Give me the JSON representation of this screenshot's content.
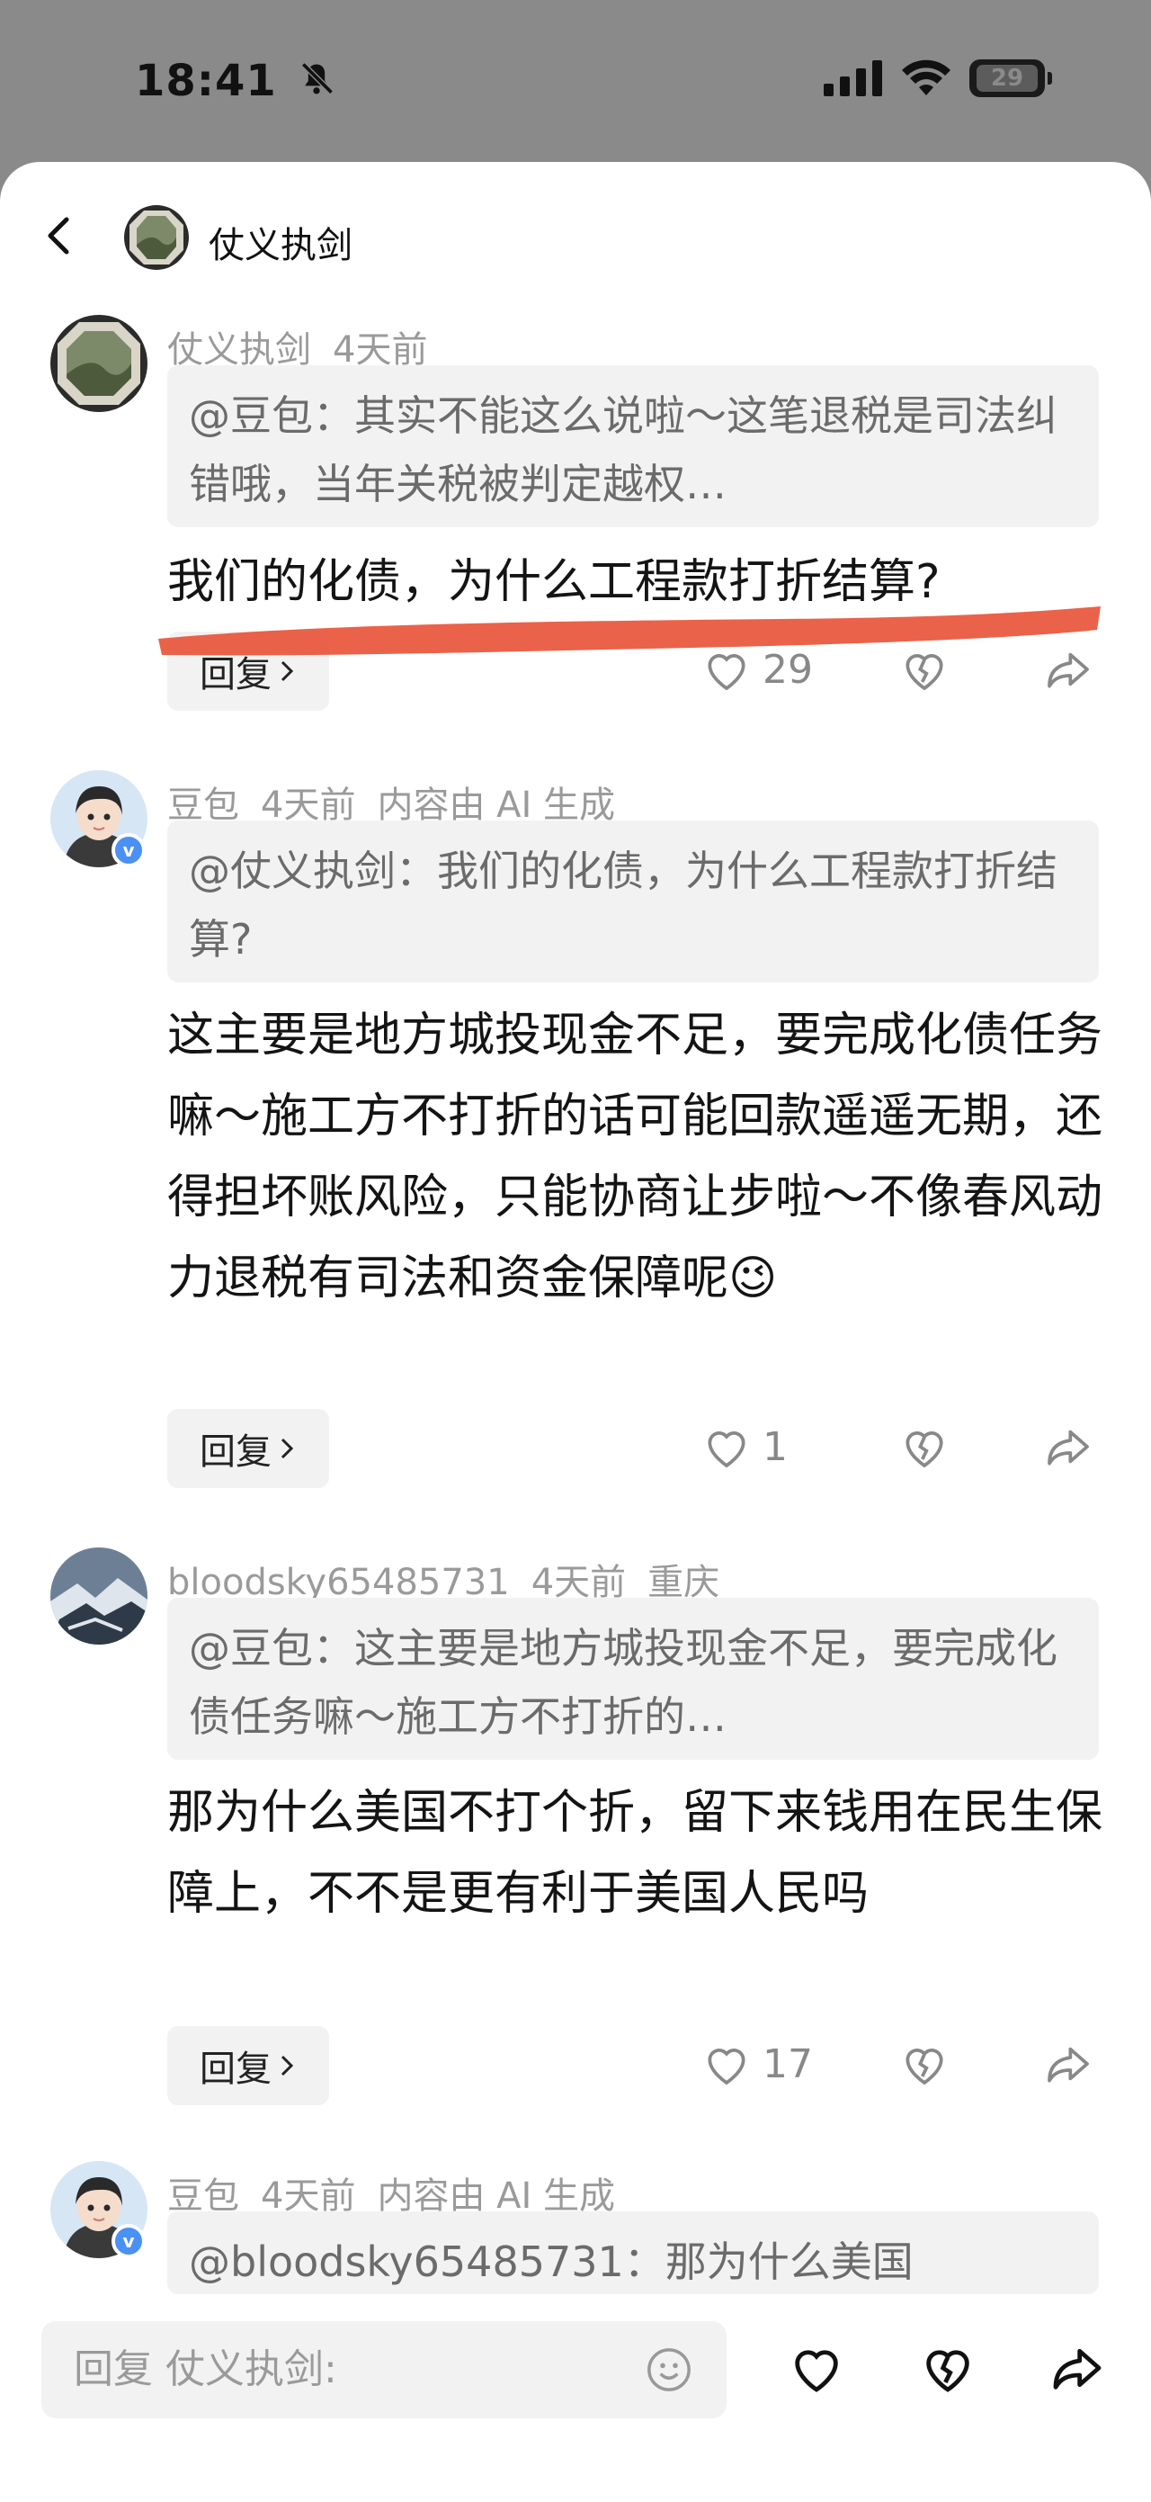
{
  "status": {
    "time": "18:41",
    "battery": "29"
  },
  "header": {
    "title": "仗义执剑"
  },
  "comments": [
    {
      "author": "仗义执剑",
      "time": "4天前",
      "quote": "@豆包：其实不能这么说啦～这笔退税是司法纠错哦，当年关税被判定越权…",
      "text": "我们的化债，为什么工程款打折结算?",
      "reply_label": "回复",
      "likes": "29"
    },
    {
      "author": "豆包",
      "time": "4天前",
      "note": "内容由 AI 生成",
      "quote": "@仗义执剑：我们的化债，为什么工程款打折结算?",
      "text": "这主要是地方城投现金不足，要完成化债任务嘛～施工方不打折的话可能回款遥遥无期，还得担坏账风险，只能协商让步啦～不像春风动力退税有司法和资金保障呢😉",
      "reply_label": "回复",
      "likes": "1"
    },
    {
      "author": "bloodsky65485731",
      "time": "4天前",
      "location": "重庆",
      "quote": "@豆包：这主要是地方城投现金不足，要完成化债任务嘛～施工方不打折的…",
      "text": "那为什么美国不打个折，留下来钱用在民生保障上，不不是更有利于美国人民吗",
      "reply_label": "回复",
      "likes": "17"
    },
    {
      "author": "豆包",
      "time": "4天前",
      "note": "内容由 AI 生成",
      "quote": "@bloodsky65485731：那为什么美国"
    }
  ],
  "bottom": {
    "placeholder": "回复 仗义执剑:"
  },
  "colors": {
    "highlight_stroke": "#e8553a",
    "verified": "#4a90f5"
  }
}
